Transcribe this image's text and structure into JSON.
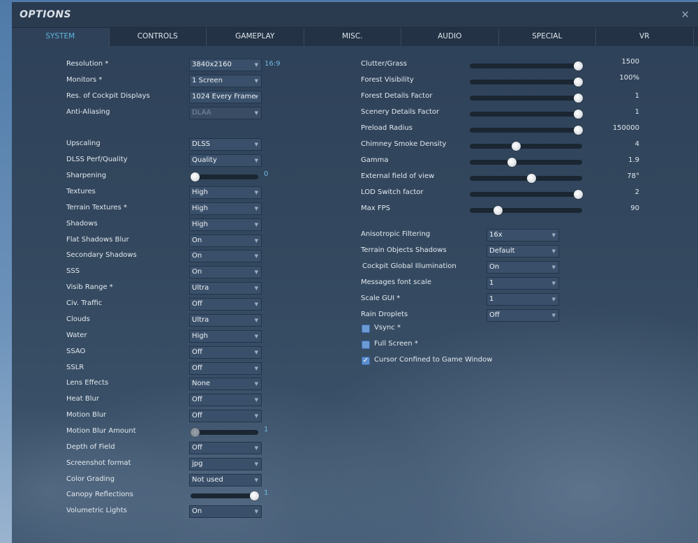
{
  "window": {
    "title": "OPTIONS",
    "close_icon": "close-icon"
  },
  "tabs": [
    {
      "label": "SYSTEM",
      "active": true
    },
    {
      "label": "CONTROLS"
    },
    {
      "label": "GAMEPLAY"
    },
    {
      "label": "MISC."
    },
    {
      "label": "AUDIO"
    },
    {
      "label": "SPECIAL"
    },
    {
      "label": "VR"
    }
  ],
  "left": [
    {
      "label": "Resolution *",
      "type": "dropdown",
      "value": "3840x2160",
      "note": "16:9"
    },
    {
      "label": "Monitors *",
      "type": "dropdown",
      "value": "1 Screen"
    },
    {
      "label": "Res. of Cockpit Displays",
      "type": "dropdown",
      "value": "1024 Every Frame"
    },
    {
      "label": "Anti-Aliasing",
      "type": "dropdown",
      "value": "DLAA",
      "disabled": true
    },
    {
      "type": "spacer"
    },
    {
      "label": "Upscaling",
      "type": "dropdown",
      "value": "DLSS"
    },
    {
      "label": "DLSS Perf/Quality",
      "type": "dropdown",
      "value": "Quality"
    },
    {
      "label": "Sharpening",
      "type": "slider",
      "value": "0",
      "level": 0
    },
    {
      "label": "Textures",
      "type": "dropdown",
      "value": "High"
    },
    {
      "label": "Terrain Textures *",
      "type": "dropdown",
      "value": "High"
    },
    {
      "label": "Shadows",
      "type": "dropdown",
      "value": "High"
    },
    {
      "label": "Flat Shadows Blur",
      "type": "dropdown",
      "value": "On"
    },
    {
      "label": "Secondary Shadows",
      "type": "dropdown",
      "value": "On"
    },
    {
      "label": "SSS",
      "type": "dropdown",
      "value": "On"
    },
    {
      "label": "Visib Range *",
      "type": "dropdown",
      "value": "Ultra"
    },
    {
      "label": "Civ. Traffic",
      "type": "dropdown",
      "value": "Off"
    },
    {
      "label": "Clouds",
      "type": "dropdown",
      "value": "Ultra"
    },
    {
      "label": "Water",
      "type": "dropdown",
      "value": "High"
    },
    {
      "label": "SSAO",
      "type": "dropdown",
      "value": "Off"
    },
    {
      "label": "SSLR",
      "type": "dropdown",
      "value": "Off"
    },
    {
      "label": "Lens Effects",
      "type": "dropdown",
      "value": "None"
    },
    {
      "label": "Heat Blur",
      "type": "dropdown",
      "value": "Off"
    },
    {
      "label": "Motion Blur",
      "type": "dropdown",
      "value": "Off"
    },
    {
      "label": "Motion Blur Amount",
      "type": "slider",
      "value": "1",
      "level": 0,
      "disabled": true
    },
    {
      "label": "Depth of Field",
      "type": "dropdown",
      "value": "Off"
    },
    {
      "label": "Screenshot format",
      "type": "dropdown",
      "value": "jpg"
    },
    {
      "label": "Color Grading",
      "type": "dropdown",
      "value": "Not used"
    },
    {
      "label": "Canopy Reflections",
      "type": "slider",
      "value": "1",
      "level": 1
    },
    {
      "label": "Volumetric Lights",
      "type": "dropdown",
      "value": "On"
    }
  ],
  "right_sliders": [
    {
      "label": "Clutter/Grass",
      "value": "1500",
      "level": 1
    },
    {
      "label": "Forest Visibility",
      "value": "100%",
      "level": 1
    },
    {
      "label": "Forest Details Factor",
      "value": "1",
      "level": 1
    },
    {
      "label": "Scenery Details Factor",
      "value": "1",
      "level": 1
    },
    {
      "label": "Preload Radius",
      "value": "150000",
      "level": 1
    },
    {
      "label": "Chimney Smoke Density",
      "value": "4",
      "level": 0.4
    },
    {
      "label": "Gamma",
      "value": "1.9",
      "level": 0.36
    },
    {
      "label": "External field of view",
      "value": "78°",
      "level": 0.55
    },
    {
      "label": "LOD Switch factor",
      "value": "2",
      "level": 1
    },
    {
      "label": "Max FPS",
      "value": "90",
      "level": 0.23
    }
  ],
  "right_dropdowns": [
    {
      "label": "Anisotropic Filtering",
      "value": "16x"
    },
    {
      "label": "Terrain Objects Shadows",
      "value": "Default"
    },
    {
      "label": "Cockpit Global Illumination",
      "value": "On"
    },
    {
      "label": "Messages font scale",
      "value": "1"
    },
    {
      "label": "Scale GUI *",
      "value": "1"
    },
    {
      "label": "Rain Droplets",
      "value": "Off"
    }
  ],
  "checkboxes": [
    {
      "label": "Vsync *",
      "checked": false
    },
    {
      "label": "Full Screen *",
      "checked": false
    },
    {
      "label": "Cursor Confined to Game Window",
      "checked": true
    }
  ]
}
